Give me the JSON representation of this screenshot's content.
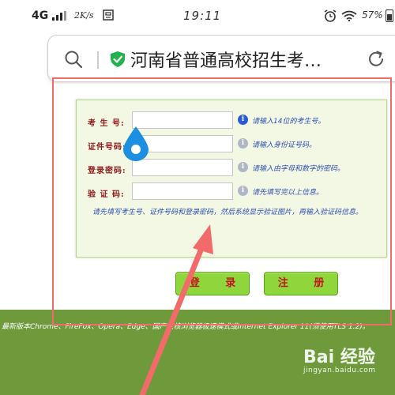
{
  "status_bar": {
    "network": "4G",
    "speed": "2K/s",
    "time": "19:11",
    "battery": "57%"
  },
  "address_bar": {
    "title": "河南省普通高校招生考…"
  },
  "form": {
    "fields": [
      {
        "label": "考 生 号:",
        "hint": "请输入14位的考生号。"
      },
      {
        "label": "证件号码:",
        "hint": "请输入身份证号码。"
      },
      {
        "label": "登录密码:",
        "hint": "请输入由字母和数字的密码。"
      },
      {
        "label": "验 证 码:",
        "hint": "请先填写完以上信息。"
      }
    ],
    "notice": "请先填写考生号、证件号码和登录密码，然后系统显示验证图片，再输入验证码信息。"
  },
  "buttons": {
    "login": "登 录",
    "register": "注 册"
  },
  "footer": {
    "text": "最新版本Chrome、FireFox、Opera、Edge、国产双核浏览器极速模式或Internet Explorer 11(须使用TLS 1.2)。"
  },
  "watermark": {
    "main": "Bai 经验",
    "sub": "jingyan.baidu.com"
  },
  "colors": {
    "panel_bg": "#f3f8e4",
    "panel_border": "#b9d48e",
    "button_bg": "#8fd63c",
    "button_text": "#c0171e",
    "footer_bg": "#6f9a3c",
    "annotation": "#f26a6a",
    "hint_text": "#2f4fb0",
    "label_text": "#8b1a1a"
  }
}
